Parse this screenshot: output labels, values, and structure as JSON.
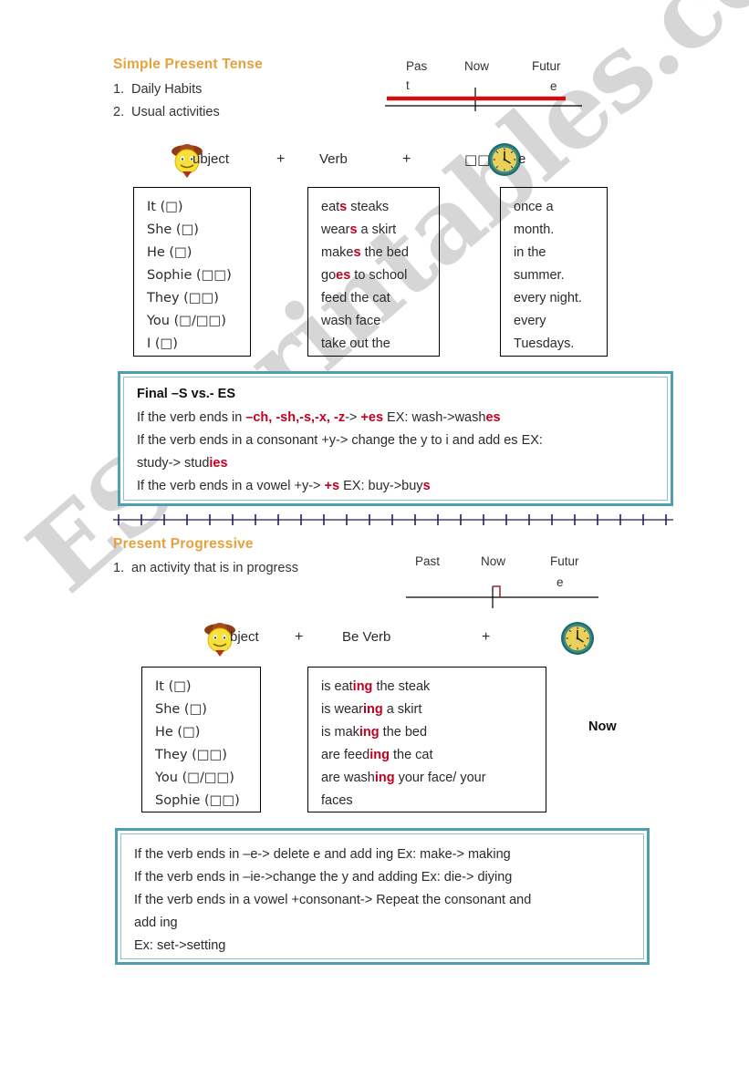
{
  "document": {
    "watermark": "ESLprintables.com"
  },
  "sections": [
    {
      "id": "simple-present",
      "title": "Simple Present Tense",
      "uses": [
        {
          "num": "1.",
          "text": "Daily Habits"
        },
        {
          "num": "2.",
          "text": "Usual activities"
        }
      ],
      "timeline": {
        "past": "Pas",
        "past_overflow": "t",
        "now": "Now",
        "future": "Futur",
        "future_overflow": "e"
      },
      "formula": {
        "subject": "ubject",
        "subject_icon": "cowboy-smiley-icon",
        "plus1": "+",
        "verb": "Verb",
        "plus2": "+",
        "time_prefix": "□□",
        "time_icon": "clock-icon",
        "time_suffix": "e"
      },
      "boxes": {
        "subjects": [
          "It (□)",
          "She (□)",
          "He (□)",
          "Sophie (□□)",
          "They (□□)",
          "You (□/□□)",
          "I (□)"
        ],
        "verbs": [
          {
            "pre": "eat",
            "hl": "s",
            "post": " steaks"
          },
          {
            "pre": "wear",
            "hl": "s",
            "post": " a skirt"
          },
          {
            "pre": "make",
            "hl": "s",
            "post": " the bed"
          },
          {
            "pre": "go",
            "hl": "es",
            "post": " to school"
          },
          {
            "pre": "feed the cat",
            "hl": "",
            "post": ""
          },
          {
            "pre": "wash face",
            "hl": "",
            "post": ""
          },
          {
            "pre": "take out the",
            "hl": "",
            "post": ""
          }
        ],
        "times": [
          "once a",
          "month.",
          "in the",
          "summer.",
          "every night.",
          "every",
          "Tuesdays."
        ]
      },
      "rule_box": {
        "title": "Final –S vs.- ES",
        "lines": [
          [
            {
              "t": "If the verb ends in ",
              "s": "plain"
            },
            {
              "t": "–ch, -sh,-s,-x, -z",
              "s": "red"
            },
            {
              "t": "-> ",
              "s": "plain"
            },
            {
              "t": "+es",
              "s": "red"
            },
            {
              "t": " EX: wash->wash",
              "s": "plain"
            },
            {
              "t": "es",
              "s": "red"
            }
          ],
          [
            {
              "t": "If the verb ends in a consonant +y-> change the y to i and add es EX:",
              "s": "plain"
            }
          ],
          [
            {
              "t": "study-> stud",
              "s": "plain"
            },
            {
              "t": "ies",
              "s": "red"
            }
          ],
          [
            {
              "t": "If the verb ends in a vowel +y-> ",
              "s": "plain"
            },
            {
              "t": "+s",
              "s": "red"
            },
            {
              "t": " EX: buy->buy",
              "s": "plain"
            },
            {
              "t": "s",
              "s": "red"
            }
          ]
        ]
      }
    },
    {
      "id": "present-progressive",
      "title": "Present Progressive",
      "uses": [
        {
          "num": "1.",
          "text": "an activity that is in progress"
        }
      ],
      "timeline": {
        "past": "Past",
        "now": "Now",
        "future": "Futur",
        "future_overflow": "e"
      },
      "formula": {
        "subject": "bject",
        "subject_icon": "cowboy-smiley-icon",
        "plus1": "+",
        "verb": "Be Verb",
        "plus2": "+",
        "time_icon": "clock-icon"
      },
      "now_label": "Now",
      "boxes": {
        "subjects": [
          "It (□)",
          "She (□)",
          "He (□)",
          "They (□□)",
          "You (□/□□)",
          "Sophie (□□)"
        ],
        "verbs": [
          {
            "pre": "is eat",
            "hl": "ing",
            "post": " the steak"
          },
          {
            "pre": "is wear",
            "hl": "ing",
            "post": " a skirt"
          },
          {
            "pre": "is mak",
            "hl": "ing",
            "post": " the bed"
          },
          {
            "pre": "are feed",
            "hl": "ing",
            "post": " the cat"
          },
          {
            "pre": "are wash",
            "hl": "ing",
            "post": " your face/ your"
          },
          {
            "pre": "faces",
            "hl": "",
            "post": ""
          }
        ]
      },
      "rule_box": {
        "title": "",
        "lines": [
          [
            {
              "t": "If the verb ends in –e-> delete e and add ing Ex: make-> making",
              "s": "plain"
            }
          ],
          [
            {
              "t": "If the verb ends in –ie->change the y and adding Ex: die-> diying",
              "s": "plain"
            }
          ],
          [
            {
              "t": "If the verb ends in a vowel +consonant-> Repeat the consonant and",
              "s": "plain"
            }
          ],
          [
            {
              "t": "add ing",
              "s": "plain"
            }
          ],
          [
            {
              "t": "Ex: set->setting",
              "s": "plain"
            }
          ]
        ]
      }
    }
  ],
  "colors": {
    "title_orange": "#e5a23c",
    "highlight_red": "#c00020",
    "rulebox_teal": "#4e9fb2",
    "divider_navy": "#1f1f5e",
    "timeline_red": "#cc1111"
  }
}
